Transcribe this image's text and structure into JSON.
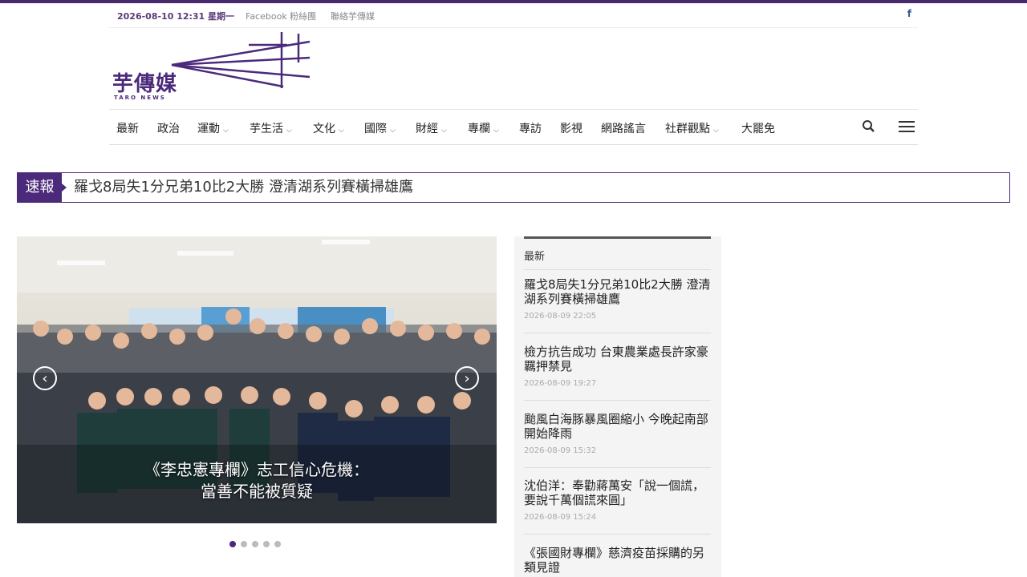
{
  "topbar": {
    "datetime": "2026-08-10 12:31 星期一",
    "links": [
      "Facebook 粉絲團",
      "聯絡芋傳媒"
    ],
    "social_icon": "f"
  },
  "logo": {
    "title": "芋傳媒",
    "subtitle": "TARO NEWS"
  },
  "nav": {
    "items": [
      {
        "label": "最新"
      },
      {
        "label": "政治"
      },
      {
        "label": "運動"
      },
      {
        "label": "芋生活"
      },
      {
        "label": "文化"
      },
      {
        "label": "國際"
      },
      {
        "label": "財經"
      },
      {
        "label": "專欄"
      },
      {
        "label": "專訪"
      },
      {
        "label": "影視"
      },
      {
        "label": "網路謠言"
      },
      {
        "label": "社群觀點"
      },
      {
        "label": "大罷免"
      }
    ],
    "icons": [
      "search-icon",
      "hamburger-menu-icon"
    ]
  },
  "ticker": {
    "label": "速報",
    "headline": "羅戈8局失1分兄弟10比2大勝 澄清湖系列賽橫掃雄鷹"
  },
  "slider": {
    "caption_line1": "《李忠憲專欄》志工信心危機：",
    "caption_line2": "當善不能被質疑",
    "prev": "‹",
    "next": "›",
    "active_slide": 1,
    "slide_count": 5
  },
  "sidebar": {
    "heading": "最新",
    "articles": [
      {
        "title": "羅戈8局失1分兄弟10比2大勝 澄清湖系列賽橫掃雄鷹",
        "time": "2026-08-09 22:05"
      },
      {
        "title": "檢方抗告成功 台東農業處長許家豪羈押禁見",
        "time": "2026-08-09 19:27"
      },
      {
        "title": "颱風白海豚暴風圈縮小 今晚起南部開始降雨",
        "time": "2026-08-09 15:32"
      },
      {
        "title": "沈伯洋：奉勸蔣萬安「說一個謊，要說千萬個謊來圓」",
        "time": "2026-08-09 15:24"
      },
      {
        "title": "《張國財專欄》慈濟疫苗採購的另類見證",
        "time": ""
      }
    ]
  },
  "colors": {
    "brand": "#4b2a7b"
  }
}
